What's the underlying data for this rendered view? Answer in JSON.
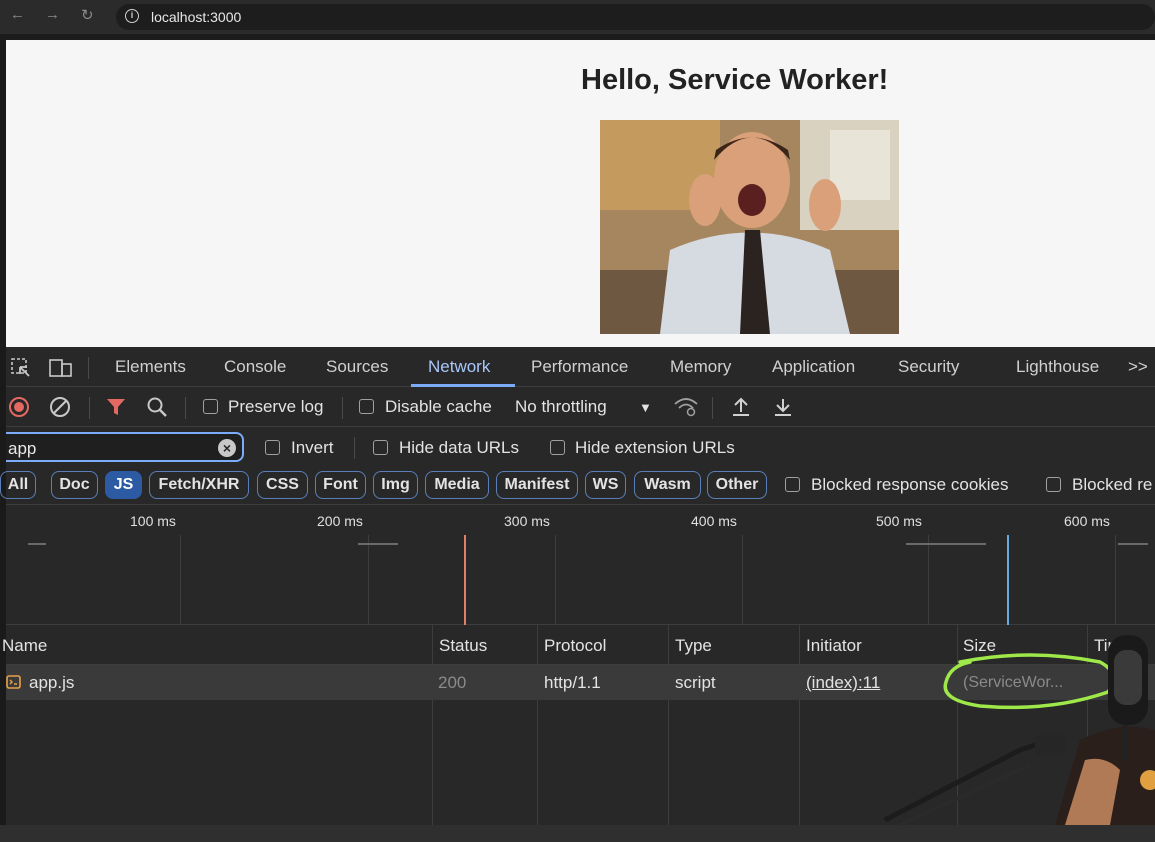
{
  "browser": {
    "url": "localhost:3000"
  },
  "page": {
    "heading": "Hello, Service Worker!"
  },
  "devtools": {
    "tabs": [
      "Elements",
      "Console",
      "Sources",
      "Network",
      "Performance",
      "Memory",
      "Application",
      "Security",
      "Lighthouse"
    ],
    "active_tab": "Network",
    "more_tabs": ">>",
    "toolbar": {
      "preserve_log": "Preserve log",
      "disable_cache": "Disable cache",
      "throttling": "No throttling"
    },
    "filter": {
      "value": "app",
      "invert": "Invert",
      "hide_data_urls": "Hide data URLs",
      "hide_extension_urls": "Hide extension URLs"
    },
    "types": [
      "All",
      "Doc",
      "JS",
      "Fetch/XHR",
      "CSS",
      "Font",
      "Img",
      "Media",
      "Manifest",
      "WS",
      "Wasm",
      "Other"
    ],
    "active_type": "JS",
    "blocked_cookies": "Blocked response cookies",
    "blocked_requests": "Blocked re",
    "timeline_ticks": [
      "100 ms",
      "200 ms",
      "300 ms",
      "400 ms",
      "500 ms",
      "600 ms"
    ],
    "columns": [
      "Name",
      "Status",
      "Protocol",
      "Type",
      "Initiator",
      "Size",
      "Tim"
    ],
    "rows": [
      {
        "name": "app.js",
        "status": "200",
        "protocol": "http/1.1",
        "type": "script",
        "initiator": "(index):11",
        "size": "(ServiceWor..."
      }
    ]
  },
  "colors": {
    "accent": "#7cacf8",
    "highlight": "#9ee84a",
    "record": "#e46962"
  }
}
